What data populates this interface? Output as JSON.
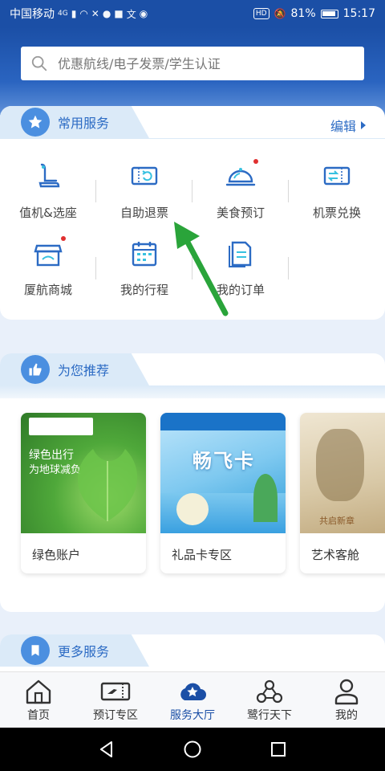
{
  "status_bar": {
    "carrier": "中国移动",
    "network": "4G",
    "battery": "81%",
    "time": "15:17"
  },
  "search": {
    "placeholder": "优惠航线/电子发票/学生认证"
  },
  "common_services": {
    "title": "常用服务",
    "edit_label": "编辑",
    "items": [
      {
        "label": "值机&选座",
        "icon": "seat-icon"
      },
      {
        "label": "自助退票",
        "icon": "refund-ticket-icon"
      },
      {
        "label": "美食预订",
        "icon": "food-cloche-icon"
      },
      {
        "label": "机票兑换",
        "icon": "ticket-exchange-icon"
      },
      {
        "label": "厦航商城",
        "icon": "shop-icon"
      },
      {
        "label": "我的行程",
        "icon": "calendar-icon"
      },
      {
        "label": "我的订单",
        "icon": "order-document-icon"
      }
    ]
  },
  "recommend": {
    "title": "为您推荐",
    "items": [
      {
        "label": "绿色账户",
        "image_text_line1": "绿色出行",
        "image_text_line2": "为地球减负"
      },
      {
        "label": "礼品卡专区",
        "image_text": "畅飞卡"
      },
      {
        "label": "艺术客舱",
        "image_text": "共启新章"
      }
    ]
  },
  "more_services": {
    "title": "更多服务"
  },
  "bottom_nav": {
    "items": [
      {
        "label": "首页",
        "icon": "home-icon",
        "active": false
      },
      {
        "label": "预订专区",
        "icon": "ticket-icon",
        "active": false
      },
      {
        "label": "服务大厅",
        "icon": "service-cloud-star-icon",
        "active": true
      },
      {
        "label": "鹭行天下",
        "icon": "community-icon",
        "active": false
      },
      {
        "label": "我的",
        "icon": "profile-icon",
        "active": false
      }
    ]
  },
  "colors": {
    "brand": "#1b4fa6",
    "accent": "#2c6bc4",
    "annotation_arrow": "#2aa43a"
  }
}
